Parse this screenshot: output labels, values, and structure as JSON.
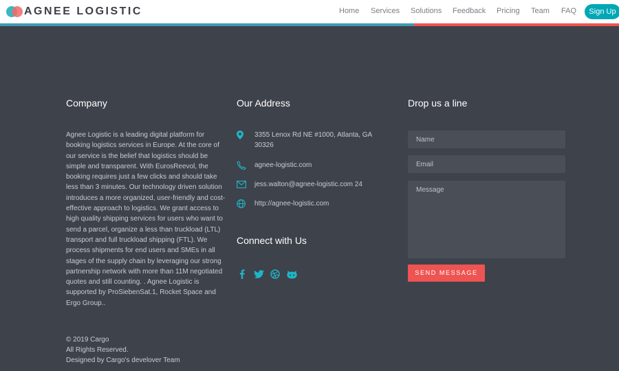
{
  "header": {
    "brand": "AGNEE LOGISTIC",
    "nav": [
      "Home",
      "Services",
      "Solutions",
      "Feedback",
      "Pricing",
      "Team",
      "FAQ"
    ],
    "signup_label": "Sign Up"
  },
  "company": {
    "title": "Company",
    "text": "Agnee Logistic is a leading digital platform for booking logistics services in Europe. At the core of our service is the belief that logistics should be simple and transparent. With EurosReevol, the booking requires just a few clicks and should take less than 3 minutes. Our technology driven solution introduces a more organized, user-friendly and cost-effective approach to logistics. We grant access to high quality shipping services for users who want to send a parcel, organize a less than truckload (LTL) transport and full truckload shipping (FTL). We process shipments for end users and SMEs in all stages of the supply chain by leveraging our strong partnership network with more than 11M negotiated quotes and still counting. . Agnee Logistic is supported by ProSiebenSat.1, Rocket Space and Ergo Group.."
  },
  "address": {
    "title": "Our Address",
    "street": "3355 Lenox Rd NE #1000, Atlanta, GA 30326",
    "phone": "agnee-logistic.com",
    "email": "jess.walton@agnee-logistic.com 24",
    "website": "http://agnee-logistic.com",
    "icons": [
      "map-pin-icon",
      "phone-icon",
      "envelope-icon",
      "globe-icon"
    ]
  },
  "connect": {
    "title": "Connect with Us",
    "icons": [
      "facebook-icon",
      "twitter-icon",
      "dribbble-icon",
      "github-icon"
    ]
  },
  "contact_form": {
    "title": "Drop us a line",
    "name_placeholder": "Name",
    "email_placeholder": "Email",
    "message_placeholder": "Message",
    "send_label": "SEND MESSAGE"
  },
  "footer": {
    "copyright": "© 2019 Cargo",
    "rights": "All Rights Reserved.",
    "designed": "Designed by Cargo's develover Team"
  },
  "colors": {
    "accent_teal": "#00a8b5",
    "accent_red": "#ee5451",
    "background": "#3e424b"
  }
}
